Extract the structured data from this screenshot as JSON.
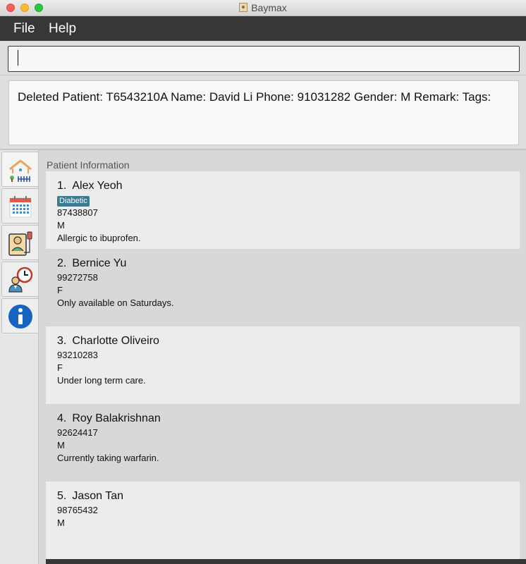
{
  "window": {
    "title": "Baymax"
  },
  "menu": {
    "file": "File",
    "help": "Help"
  },
  "command": {
    "value": ""
  },
  "result": {
    "text": "Deleted Patient: T6543210A Name: David Li Phone: 91031282 Gender: M Remark:  Tags:"
  },
  "sidebar": {
    "tabs": [
      {
        "icon": "home-icon"
      },
      {
        "icon": "calendar-icon"
      },
      {
        "icon": "patient-monitor-icon"
      },
      {
        "icon": "doctor-clock-icon"
      },
      {
        "icon": "info-icon"
      }
    ]
  },
  "panel": {
    "label": "Patient Information",
    "patients": [
      {
        "index": "1.",
        "name": "Alex Yeoh",
        "tag": "Diabetic",
        "phone": "87438807",
        "gender": "M",
        "remark": "Allergic to ibuprofen."
      },
      {
        "index": "2.",
        "name": "Bernice Yu",
        "phone": "99272758",
        "gender": "F",
        "remark": "Only available on Saturdays."
      },
      {
        "index": "3.",
        "name": "Charlotte Oliveiro",
        "phone": "93210283",
        "gender": "F",
        "remark": "Under long term care."
      },
      {
        "index": "4.",
        "name": "Roy Balakrishnan",
        "phone": "92624417",
        "gender": "M",
        "remark": "Currently taking warfarin."
      },
      {
        "index": "5.",
        "name": "Jason Tan",
        "phone": "98765432",
        "gender": "M",
        "remark": ""
      }
    ]
  },
  "colors": {
    "menubar": "#373737",
    "tag": "#3e7b91",
    "card_odd": "#ececec",
    "card_even": "#d8d8d8"
  }
}
